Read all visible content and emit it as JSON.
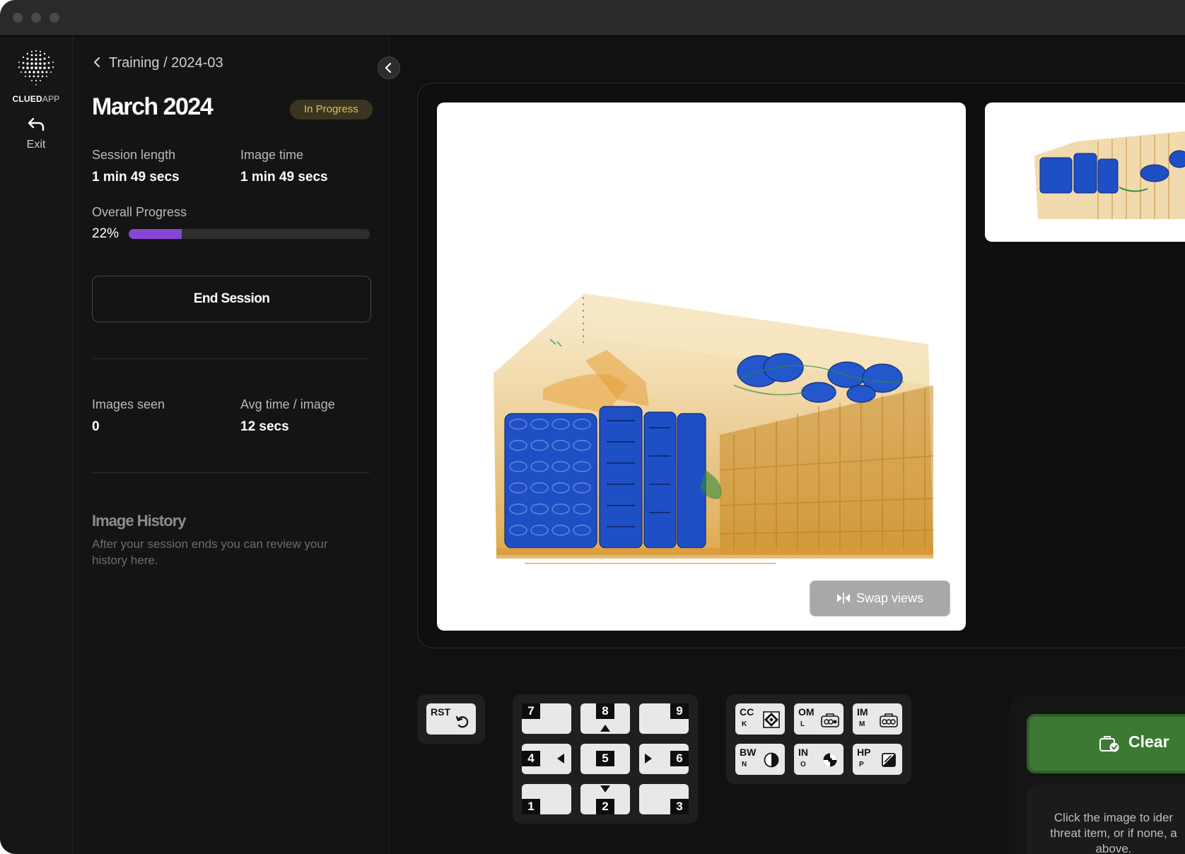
{
  "app": {
    "logo_bold": "CLUED",
    "logo_light": "APP",
    "exit_label": "Exit"
  },
  "breadcrumb": "Training / 2024-03",
  "session": {
    "title": "March 2024",
    "status": "In Progress",
    "session_length_label": "Session length",
    "session_length_value": "1 min 49 secs",
    "image_time_label": "Image time",
    "image_time_value": "1 min 49 secs",
    "overall_progress_label": "Overall Progress",
    "progress_text": "22%",
    "progress_fraction": 0.22,
    "end_session_label": "End Session",
    "images_seen_label": "Images seen",
    "images_seen_value": "0",
    "avg_time_label": "Avg time / image",
    "avg_time_value": "12 secs"
  },
  "history": {
    "title": "Image History",
    "description": "After your session ends you can review your history here."
  },
  "viewer": {
    "swap_label": "Swap views"
  },
  "reset_key": {
    "label": "RST",
    "icon": "rotate-ccw-icon"
  },
  "numpad": [
    {
      "num": "7"
    },
    {
      "num": "8",
      "arrow": "up"
    },
    {
      "num": "9"
    },
    {
      "num": "4",
      "arrow": "left"
    },
    {
      "num": "5"
    },
    {
      "num": "6",
      "arrow": "right"
    },
    {
      "num": "1"
    },
    {
      "num": "2",
      "arrow": "down"
    },
    {
      "num": "3"
    }
  ],
  "function_keys": [
    {
      "code": "CC",
      "sub": "K",
      "icon": "contrast-diamond-icon"
    },
    {
      "code": "OM",
      "sub": "L",
      "icon": "bag-organic-icon"
    },
    {
      "code": "IM",
      "sub": "M",
      "icon": "bag-inorganic-icon"
    },
    {
      "code": "BW",
      "sub": "N",
      "icon": "half-circle-icon"
    },
    {
      "code": "IN",
      "sub": "O",
      "icon": "invert-icon"
    },
    {
      "code": "HP",
      "sub": "P",
      "icon": "high-pass-icon"
    }
  ],
  "clear_button": {
    "label": "Clear",
    "icon": "bag-check-icon"
  },
  "hint": {
    "line1": "Click the image to ider",
    "line2": "threat item, or if none, a",
    "line3": "above."
  },
  "colors": {
    "accent_purple": "#8a45d6",
    "clear_green": "#3c7a34",
    "badge_text": "#e0c25a",
    "xray_orange": "#e8a23a",
    "xray_blue": "#1f4fc4"
  }
}
